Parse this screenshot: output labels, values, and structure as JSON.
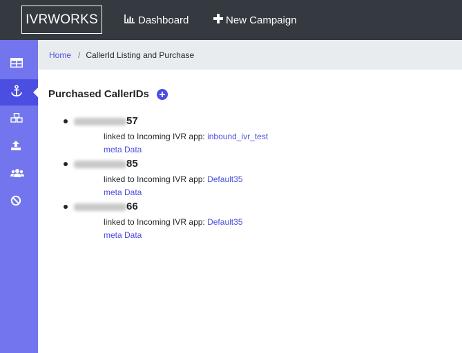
{
  "navbar": {
    "brand": "IVRWORKS",
    "links": [
      {
        "label": "Dashboard",
        "icon": "bar-chart-icon"
      },
      {
        "label": "New Campaign",
        "icon": "plus-icon"
      }
    ]
  },
  "sidebar": {
    "items": [
      {
        "icon": "table-icon",
        "active": false
      },
      {
        "icon": "anchor-icon",
        "active": true
      },
      {
        "icon": "cubes-icon",
        "active": false
      },
      {
        "icon": "upload-icon",
        "active": false
      },
      {
        "icon": "users-icon",
        "active": false
      },
      {
        "icon": "ban-icon",
        "active": false
      }
    ]
  },
  "breadcrumb": {
    "home": "Home",
    "separator": "/",
    "current": "CallerId Listing and Purchase"
  },
  "page": {
    "title": "Purchased CallerIDs"
  },
  "callerids": [
    {
      "suffix": "57",
      "linked_label": "linked to Incoming IVR app:",
      "app": "inbound_ivr_test",
      "meta": "meta Data"
    },
    {
      "suffix": "85",
      "linked_label": "linked to Incoming IVR app:",
      "app": "Default35",
      "meta": "meta Data"
    },
    {
      "suffix": "66",
      "linked_label": "linked to Incoming IVR app:",
      "app": "Default35",
      "meta": "meta Data"
    }
  ],
  "colors": {
    "navbar": "#343a40",
    "sidebar": "#7375ee",
    "sidebar_active": "#4b4ee0",
    "link": "#4b4ee0",
    "breadcrumb_bg": "#e9ecef"
  }
}
